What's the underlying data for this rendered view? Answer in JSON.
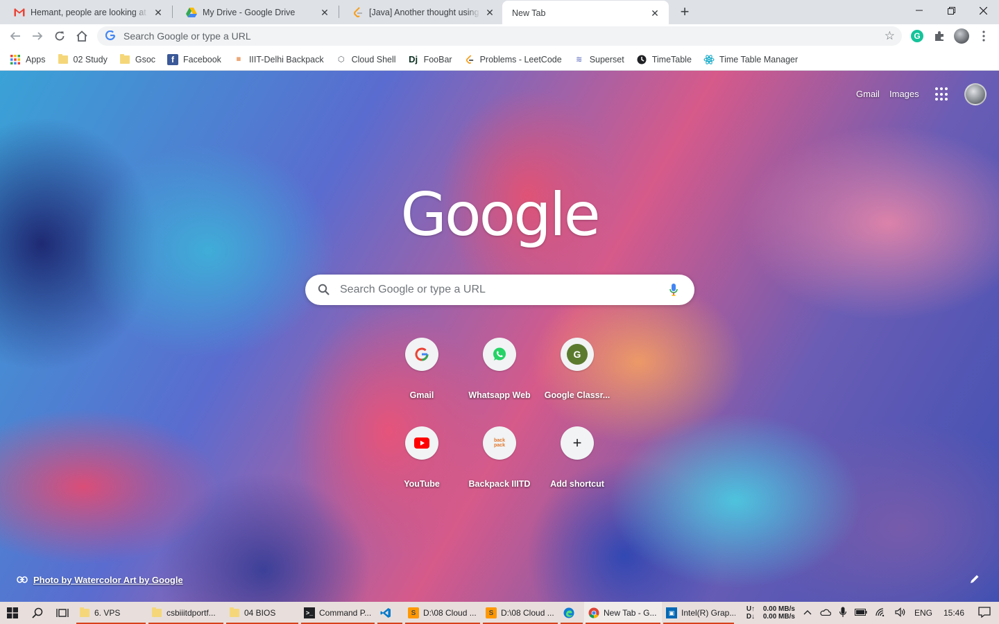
{
  "tabs": [
    {
      "title": "Hemant, people are looking at your LinkedIn profile",
      "icon": "gmail-icon",
      "active": false
    },
    {
      "title": "My Drive - Google Drive",
      "icon": "drive-icon",
      "active": false
    },
    {
      "title": "[Java] Another thought using deque",
      "icon": "leetcode-icon",
      "active": false
    },
    {
      "title": "New Tab",
      "icon": "",
      "active": true
    }
  ],
  "toolbar": {
    "omnibox_placeholder": "Search Google or type a URL"
  },
  "bookmarks": [
    {
      "label": "Apps",
      "icon": "apps-icon"
    },
    {
      "label": "02 Study",
      "icon": "folder-icon"
    },
    {
      "label": "Gsoc",
      "icon": "folder-icon"
    },
    {
      "label": "Facebook",
      "icon": "facebook-icon"
    },
    {
      "label": "IIIT-Delhi Backpack",
      "icon": "backpack-icon"
    },
    {
      "label": "Cloud Shell",
      "icon": "cloud-shell-icon"
    },
    {
      "label": "FooBar",
      "icon": "django-icon"
    },
    {
      "label": "Problems - LeetCode",
      "icon": "leetcode-icon"
    },
    {
      "label": "Superset",
      "icon": "superset-icon"
    },
    {
      "label": "TimeTable",
      "icon": "timetable-icon"
    },
    {
      "label": "Time Table Manager",
      "icon": "react-icon"
    }
  ],
  "ntp": {
    "gmail_link": "Gmail",
    "images_link": "Images",
    "logo_text": "Google",
    "search_placeholder": "Search Google or type a URL",
    "shortcuts": [
      {
        "label": "Gmail",
        "icon": "google-g-icon"
      },
      {
        "label": "Whatsapp Web",
        "icon": "whatsapp-icon"
      },
      {
        "label": "Google Classr...",
        "icon": "classroom-icon"
      },
      {
        "label": "YouTube",
        "icon": "youtube-icon"
      },
      {
        "label": "Backpack IIITD",
        "icon": "backpack-icon"
      },
      {
        "label": "Add shortcut",
        "icon": "plus-icon"
      }
    ],
    "attribution": "Photo by Watercolor Art by Google"
  },
  "taskbar": {
    "apps": [
      {
        "label": "6. VPS",
        "icon": "folder-icon"
      },
      {
        "label": "csbiiitdportf...",
        "icon": "folder-icon"
      },
      {
        "label": "04 BIOS",
        "icon": "folder-icon"
      },
      {
        "label": "Command P...",
        "icon": "cmd-icon"
      },
      {
        "label": "",
        "icon": "vscode-icon"
      },
      {
        "label": "D:\\08 Cloud ...",
        "icon": "sublime-icon"
      },
      {
        "label": "D:\\08 Cloud ...",
        "icon": "sublime-icon"
      },
      {
        "label": "",
        "icon": "edge-icon"
      },
      {
        "label": "New Tab - G...",
        "icon": "chrome-icon"
      },
      {
        "label": "Intel(R) Grap...",
        "icon": "intel-icon"
      }
    ],
    "net_up_label": "U↑",
    "net_down_label": "D↓",
    "net_up": "0.00 MB/s",
    "net_down": "0.00 MB/s",
    "language": "ENG",
    "time": "15:46"
  },
  "colors": {
    "tabstrip": "#dee1e6",
    "toolbar": "#ffffff",
    "taskbar": "#e8dfdc",
    "taskbar_accent": "#d9411b"
  }
}
